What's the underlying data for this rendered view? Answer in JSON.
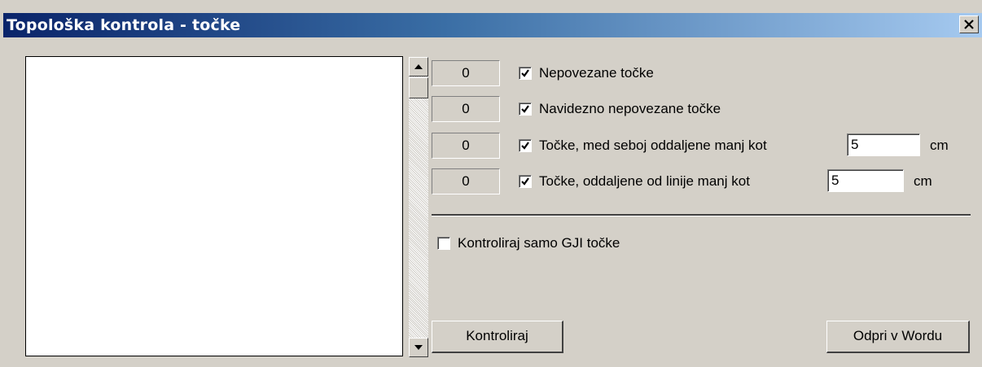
{
  "window": {
    "title": "Topološka kontrola - točke",
    "close_label": "X"
  },
  "counters": [
    {
      "count": "0",
      "checked": true,
      "label": "Nepovezane točke"
    },
    {
      "count": "0",
      "checked": true,
      "label": "Navidezno nepovezane točke"
    },
    {
      "count": "0",
      "checked": true,
      "label": "Točke, med seboj oddaljene manj kot",
      "input_value": "5",
      "unit": "cm"
    },
    {
      "count": "0",
      "checked": true,
      "label": "Točke, oddaljene od linije manj kot",
      "input_value": "5",
      "unit": "cm"
    }
  ],
  "gji_option": {
    "checked": false,
    "label": "Kontroliraj samo GJI točke"
  },
  "buttons": {
    "check": "Kontroliraj",
    "open_word": "Odpri v Wordu"
  },
  "icons": {
    "close": "close-icon",
    "scroll_up": "scroll-up-arrow-icon",
    "scroll_down": "scroll-down-arrow-icon",
    "checkmark": "checkmark-icon"
  }
}
